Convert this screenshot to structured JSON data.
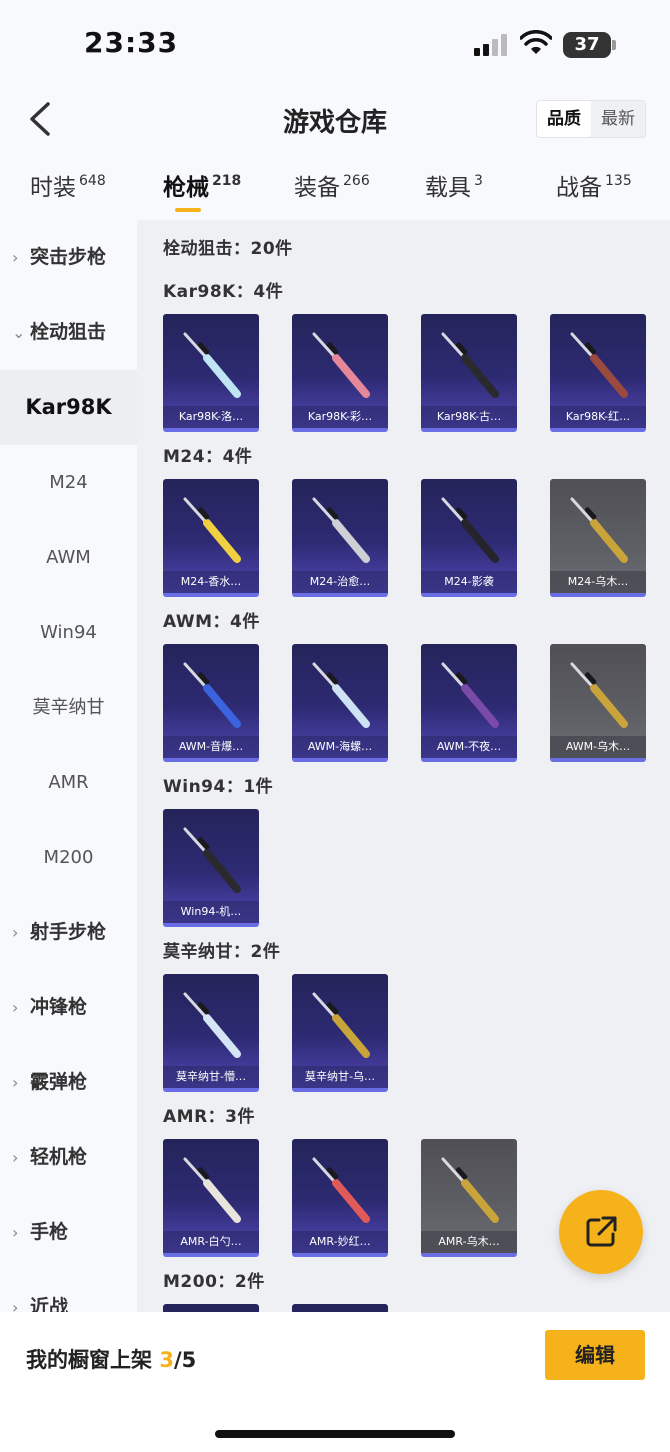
{
  "status": {
    "time": "23:33",
    "battery": "37"
  },
  "header": {
    "title": "游戏仓库",
    "sort_options": [
      "品质",
      "最新"
    ]
  },
  "tabs": [
    {
      "label": "时装",
      "count": "648"
    },
    {
      "label": "枪械",
      "count": "218"
    },
    {
      "label": "装备",
      "count": "266"
    },
    {
      "label": "载具",
      "count": "3"
    },
    {
      "label": "战备",
      "count": "135"
    }
  ],
  "sidebar": [
    {
      "label": "突击步枪",
      "kind": "cat",
      "chev": "›"
    },
    {
      "label": "栓动狙击",
      "kind": "cat",
      "chev": "⌄"
    },
    {
      "label": "Kar98K",
      "kind": "sub"
    },
    {
      "label": "M24",
      "kind": "sub"
    },
    {
      "label": "AWM",
      "kind": "sub"
    },
    {
      "label": "Win94",
      "kind": "sub"
    },
    {
      "label": "莫辛纳甘",
      "kind": "sub"
    },
    {
      "label": "AMR",
      "kind": "sub"
    },
    {
      "label": "M200",
      "kind": "sub"
    },
    {
      "label": "射手步枪",
      "kind": "cat",
      "chev": "›"
    },
    {
      "label": "冲锋枪",
      "kind": "cat",
      "chev": "›"
    },
    {
      "label": "霰弹枪",
      "kind": "cat",
      "chev": "›"
    },
    {
      "label": "轻机枪",
      "kind": "cat",
      "chev": "›"
    },
    {
      "label": "手枪",
      "kind": "cat",
      "chev": "›"
    },
    {
      "label": "近战",
      "kind": "cat",
      "chev": "›"
    }
  ],
  "content": {
    "category_title": "栓动狙击：20件",
    "sections": [
      {
        "title": "Kar98K：4件",
        "items": [
          {
            "label": "Kar98K-洛…",
            "grey": false,
            "color": "#bfe4f4"
          },
          {
            "label": "Kar98K-彩…",
            "grey": false,
            "color": "#e7889a"
          },
          {
            "label": "Kar98K-古…",
            "grey": false,
            "color": "#2a2a2e"
          },
          {
            "label": "Kar98K-红…",
            "grey": false,
            "color": "#9a4a3e"
          }
        ]
      },
      {
        "title": "M24：4件",
        "items": [
          {
            "label": "M24-香水…",
            "grey": false,
            "color": "#f0d040"
          },
          {
            "label": "M24-治愈…",
            "grey": false,
            "color": "#cfcfd6"
          },
          {
            "label": "M24-影袭",
            "grey": false,
            "color": "#24242a"
          },
          {
            "label": "M24-乌木…",
            "grey": true,
            "color": "#c9a43a"
          }
        ]
      },
      {
        "title": "AWM：4件",
        "items": [
          {
            "label": "AWM-音爆…",
            "grey": false,
            "color": "#3b63e0"
          },
          {
            "label": "AWM-海螺…",
            "grey": false,
            "color": "#cfe2f4"
          },
          {
            "label": "AWM-不夜…",
            "grey": false,
            "color": "#7a4aa8"
          },
          {
            "label": "AWM-乌木…",
            "grey": true,
            "color": "#c9a43a"
          }
        ]
      },
      {
        "title": "Win94：1件",
        "items": [
          {
            "label": "Win94-机…",
            "grey": false,
            "color": "#2a2a2e"
          }
        ]
      },
      {
        "title": "莫辛纳甘：2件",
        "items": [
          {
            "label": "莫辛纳甘-懵…",
            "grey": false,
            "color": "#d4e6f6"
          },
          {
            "label": "莫辛纳甘-乌…",
            "grey": false,
            "color": "#c9a43a"
          }
        ]
      },
      {
        "title": "AMR：3件",
        "items": [
          {
            "label": "AMR-白勺…",
            "grey": false,
            "color": "#e8e4dc"
          },
          {
            "label": "AMR-妙红…",
            "grey": false,
            "color": "#e05a5a"
          },
          {
            "label": "AMR-乌木…",
            "grey": true,
            "color": "#c9a43a"
          }
        ]
      },
      {
        "title": "M200：2件",
        "items": [
          {
            "label": "",
            "grey": false,
            "color": "#2a2a2e"
          },
          {
            "label": "",
            "grey": false,
            "color": "#2a2a2e"
          }
        ]
      }
    ]
  },
  "shelf": {
    "prefix": "我的橱窗上架 ",
    "current": "3",
    "total": "/5"
  },
  "edit_label": "编辑",
  "colors": {
    "accent": "#f6b21b",
    "card_bg": "#2d2a72",
    "card_grey": "#5e5e65"
  }
}
